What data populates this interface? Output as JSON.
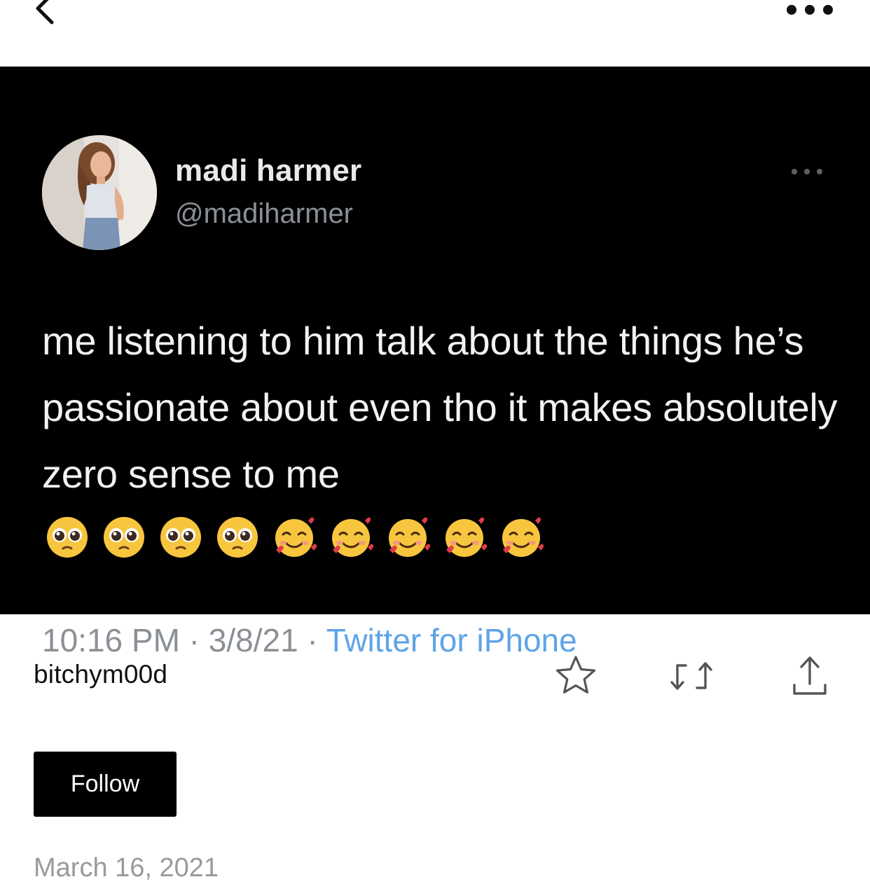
{
  "header": {
    "back_icon": "chevron-left-icon",
    "more_icon": "ellipsis-icon"
  },
  "tweet": {
    "display_name": "madi harmer",
    "handle": "@madiharmer",
    "text": "me listening to him talk about the things he’s passionate about even tho it makes absolutely zero sense to me",
    "emojis": [
      "pleading-face",
      "pleading-face",
      "pleading-face",
      "pleading-face",
      "smiling-face-with-hearts",
      "smiling-face-with-hearts",
      "smiling-face-with-hearts",
      "smiling-face-with-hearts",
      "smiling-face-with-hearts"
    ],
    "time": "10:16 PM",
    "date": "3/8/21",
    "source": "Twitter for iPhone",
    "source_color": "#5ea4e8"
  },
  "post": {
    "username": "bitchym00d",
    "follow_label": "Follow",
    "date": "March 16, 2021",
    "actions": [
      "star-icon",
      "reblog-icon",
      "share-icon"
    ]
  }
}
